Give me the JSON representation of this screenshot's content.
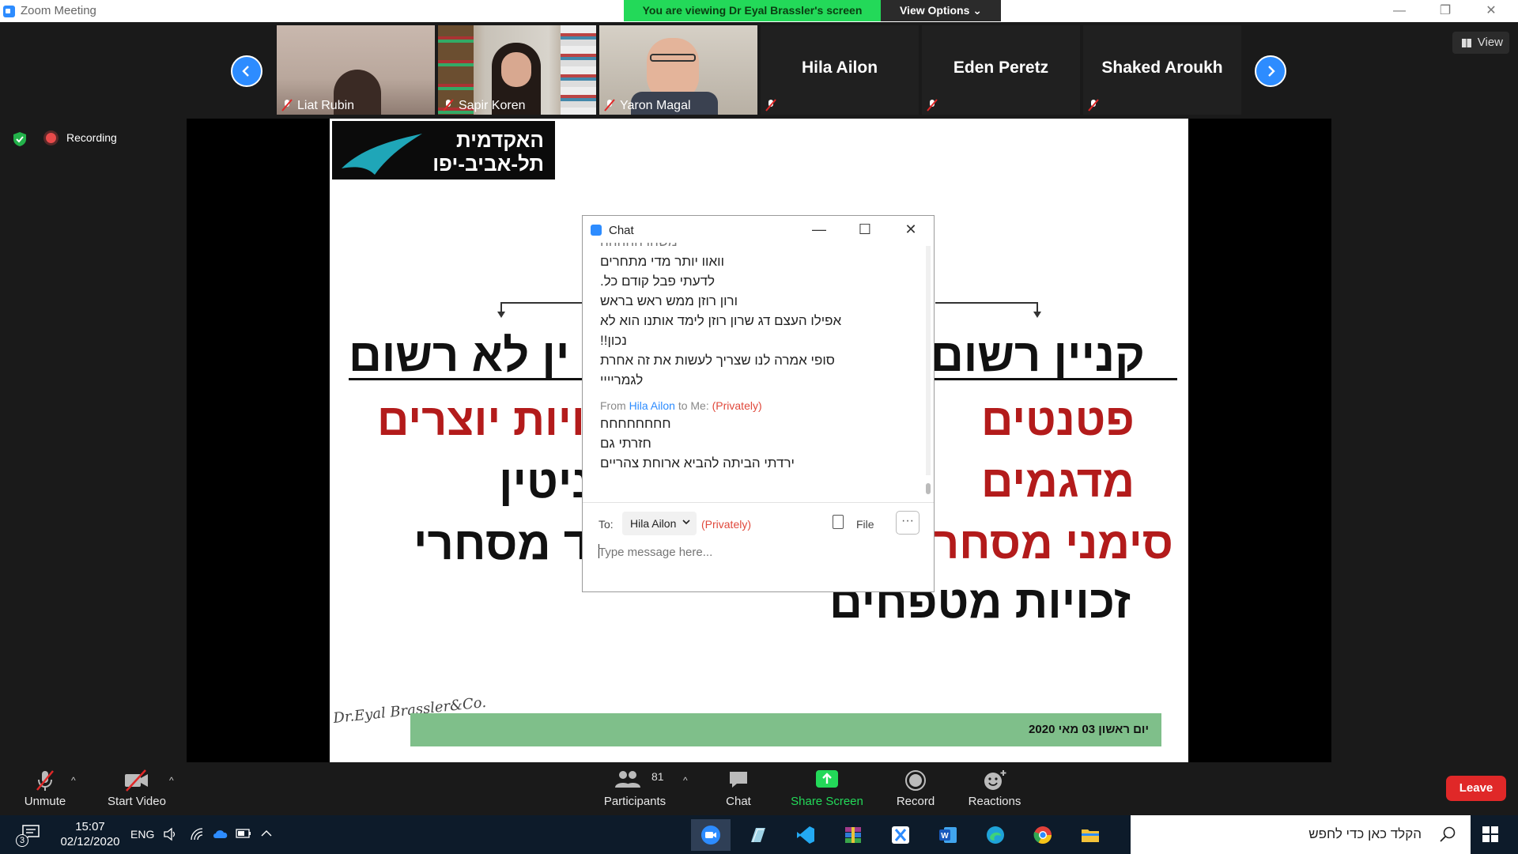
{
  "window": {
    "title": "Zoom Meeting",
    "banner": "You are viewing Dr Eyal Brassler's screen",
    "view_options": "View Options"
  },
  "thumbnails": [
    {
      "name": "Liat Rubin",
      "has_video": true
    },
    {
      "name": "Sapir Koren",
      "has_video": true
    },
    {
      "name": "Yaron Magal",
      "has_video": true
    },
    {
      "name": "Hila Ailon",
      "has_video": false
    },
    {
      "name": "Eden Peretz",
      "has_video": false
    },
    {
      "name": "Shaked Aroukh",
      "has_video": false
    }
  ],
  "view_button": "View",
  "recording_label": "Recording",
  "slide": {
    "logo_line1": "האקדמית",
    "logo_line2": "תל-אביב-יפו",
    "heading_right": "קניין רשום",
    "heading_left": "קניין לא רשום",
    "heading_left_visible": "ין לא רשום",
    "right_items": [
      "פטנטים",
      "מדגמים",
      "סימני מסחר",
      "זכויות מטפחים"
    ],
    "left_items_visible": [
      "ויות יוצרים",
      "ניטין",
      "סוד מסחרי"
    ],
    "footer_date": "יום ראשון 03 מאי 2020",
    "signature": "Dr.Eyal Brassler&Co."
  },
  "chat": {
    "title": "Chat",
    "messages": [
      "משהו ההההה",
      "וואוו יותר מדי מתחרים",
      "לדעתי פבל קודם כל.",
      "ורון רוזן ממש ראש בראש",
      "אפילו העצם דג שרון רוזן לימד אותנו הוא לא",
      "נכון!!",
      "סופי אמרה לנו שצריך לעשות את זה אחרת",
      "לגמריייי"
    ],
    "from_prefix": "From",
    "from_name": "Hila Ailon",
    "from_to": "to Me:",
    "from_private": "(Privately)",
    "messages2": [
      "חחחחחחחח",
      "חזרתי גם",
      "ירדתי הביתה להביא ארוחת צהריים"
    ],
    "to_label": "To:",
    "to_value": "Hila Ailon",
    "to_private": "(Privately)",
    "file_label": "File",
    "more_label": "···",
    "input_placeholder": "Type message here..."
  },
  "controls": {
    "unmute": "Unmute",
    "start_video": "Start Video",
    "participants": "Participants",
    "participants_count": "81",
    "chat": "Chat",
    "share_screen": "Share Screen",
    "record": "Record",
    "reactions": "Reactions",
    "leave": "Leave"
  },
  "taskbar": {
    "notification_count": "3",
    "time": "15:07",
    "date": "02/12/2020",
    "language": "ENG",
    "search_placeholder": "הקלד כאן כדי לחפש"
  },
  "colors": {
    "zoom_blue": "#2d8cff",
    "banner_green": "#23d959",
    "leave_red": "#e02828",
    "slide_red": "#b31b1b",
    "slide_footer_green": "#7fbf8a"
  }
}
